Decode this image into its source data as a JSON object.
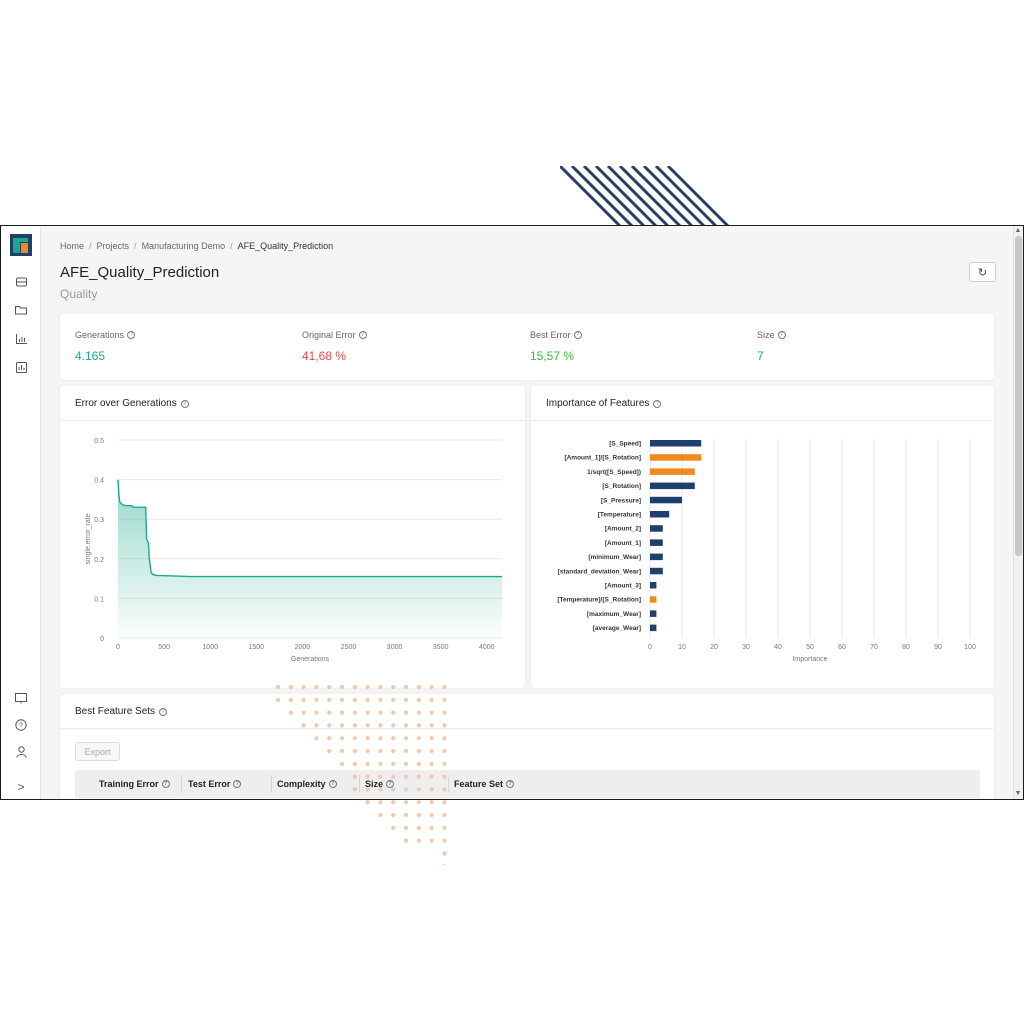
{
  "breadcrumb": [
    "Home",
    "Projects",
    "Manufacturing Demo",
    "AFE_Quality_Prediction"
  ],
  "page": {
    "title": "AFE_Quality_Prediction",
    "subtitle": "Quality"
  },
  "stats": [
    {
      "label": "Generations",
      "value": "4.165",
      "color": "#1aa98a"
    },
    {
      "label": "Original Error",
      "value": "41,68 %",
      "color": "#e8474a"
    },
    {
      "label": "Best Error",
      "value": "15,57 %",
      "color": "#3cb83c"
    },
    {
      "label": "Size",
      "value": "7",
      "color": "#1aa98a"
    }
  ],
  "error_card": {
    "title": "Error over Generations"
  },
  "importance_card": {
    "title": "Importance of Features"
  },
  "feature_sets": {
    "title": "Best Feature Sets",
    "export_label": "Export",
    "columns": [
      "Training Error",
      "Test Error",
      "Complexity",
      "Size",
      "Feature Set"
    ]
  },
  "colors": {
    "accent": "#1aa98a",
    "navy": "#1f3f6e",
    "orange": "#f08a1c"
  },
  "chart_data": [
    {
      "type": "area",
      "title": "",
      "xlabel": "Generations",
      "ylabel": "single.error_rate",
      "xlim": [
        0,
        4165
      ],
      "ylim": [
        0,
        0.5
      ],
      "xticks": [
        0,
        500,
        1000,
        1500,
        2000,
        2500,
        3000,
        3500,
        4000
      ],
      "yticks": [
        0,
        0.1,
        0.2,
        0.3,
        0.4,
        0.5
      ],
      "grid": true,
      "x": [
        0,
        10,
        20,
        50,
        100,
        150,
        170,
        300,
        310,
        330,
        340,
        360,
        380,
        420,
        800,
        4165
      ],
      "y": [
        0.4,
        0.36,
        0.343,
        0.336,
        0.334,
        0.334,
        0.33,
        0.33,
        0.25,
        0.24,
        0.2,
        0.165,
        0.16,
        0.158,
        0.155,
        0.155
      ]
    },
    {
      "type": "bar",
      "orientation": "horizontal",
      "title": "",
      "xlabel": "Importance",
      "xlim": [
        0,
        100
      ],
      "xticks": [
        0,
        10,
        20,
        30,
        40,
        50,
        60,
        70,
        80,
        90,
        100
      ],
      "grid": true,
      "categories": [
        "[S_Speed]",
        "[Amount_1]/[S_Rotation]",
        "1/sqrt([S_Speed])",
        "[S_Rotation]",
        "[S_Pressure]",
        "[Temperature]",
        "[Amount_2]",
        "[Amount_1]",
        "[minimum_Wear]",
        "[standard_deviation_Wear]",
        "[Amount_3]",
        "[Temperature]/[S_Rotation]",
        "[maximum_Wear]",
        "[average_Wear]"
      ],
      "values": [
        16,
        16,
        14,
        14,
        10,
        6,
        4,
        4,
        4,
        4,
        2,
        2,
        2,
        2
      ],
      "highlight": [
        false,
        true,
        true,
        false,
        false,
        false,
        false,
        false,
        false,
        false,
        false,
        true,
        false,
        false
      ]
    }
  ]
}
